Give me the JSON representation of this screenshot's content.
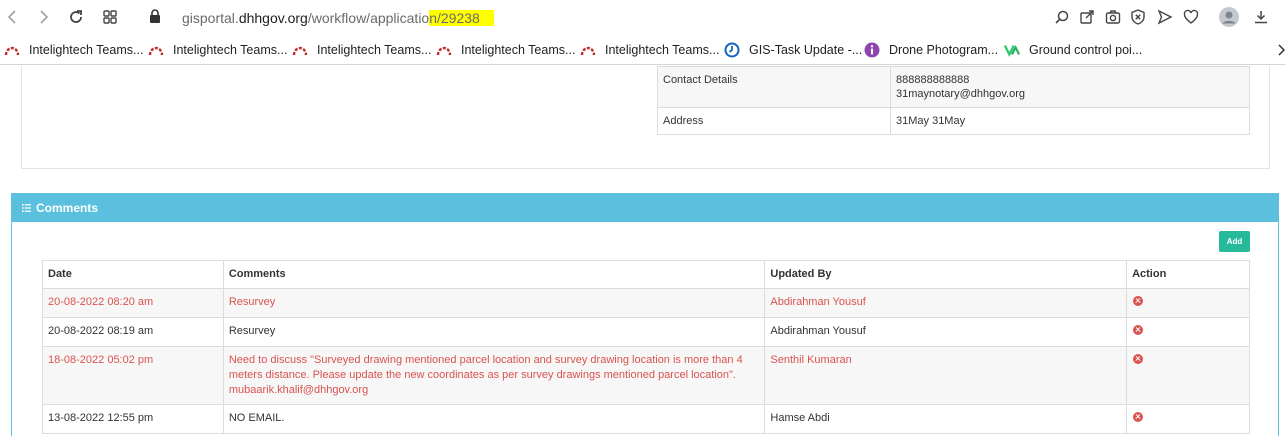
{
  "browser": {
    "url_prefix": "gisportal.",
    "url_host": "dhhgov.org",
    "url_path": "/workflow/applicatio",
    "url_highlight": "n/29238",
    "bookmarks": [
      {
        "label": "Intelightech Teams..."
      },
      {
        "label": "Intelightech Teams..."
      },
      {
        "label": "Intelightech Teams..."
      },
      {
        "label": "Intelightech Teams..."
      },
      {
        "label": "Intelightech Teams..."
      },
      {
        "label": "GIS-Task Update -..."
      },
      {
        "label": "Drone Photogram..."
      },
      {
        "label": "Ground control poi..."
      }
    ]
  },
  "details": {
    "rows": [
      {
        "key": "Contact Details",
        "value1": "888888888888",
        "value2": "31maynotary@dhhgov.org"
      },
      {
        "key": "Address",
        "value1": "31May 31May"
      }
    ]
  },
  "comments_panel": {
    "title": "Comments",
    "add_label": "Add",
    "headers": {
      "date": "Date",
      "comments": "Comments",
      "updated_by": "Updated By",
      "action": "Action"
    },
    "rows": [
      {
        "date": "20-08-2022 08:20 am",
        "comment": "Resurvey",
        "updated_by": "Abdirahman Yousuf",
        "flag": true
      },
      {
        "date": "20-08-2022 08:19 am",
        "comment": "Resurvey",
        "updated_by": "Abdirahman Yousuf",
        "flag": false
      },
      {
        "date": "18-08-2022 05:02 pm",
        "comment": "Need to discuss \"Surveyed drawing mentioned parcel location and survey drawing location is more than 4 meters distance. Please update the new coordinates as per survey drawings mentioned parcel location\". mubaarik.khalif@dhhgov.org",
        "updated_by": "Senthil Kumaran",
        "flag": true
      },
      {
        "date": "13-08-2022 12:55 pm",
        "comment": "NO EMAIL.",
        "updated_by": "Hamse Abdi",
        "flag": false
      }
    ]
  },
  "colors": {
    "accent": "#5bc0de",
    "add_button": "#26b99a",
    "danger": "#d9534f"
  }
}
